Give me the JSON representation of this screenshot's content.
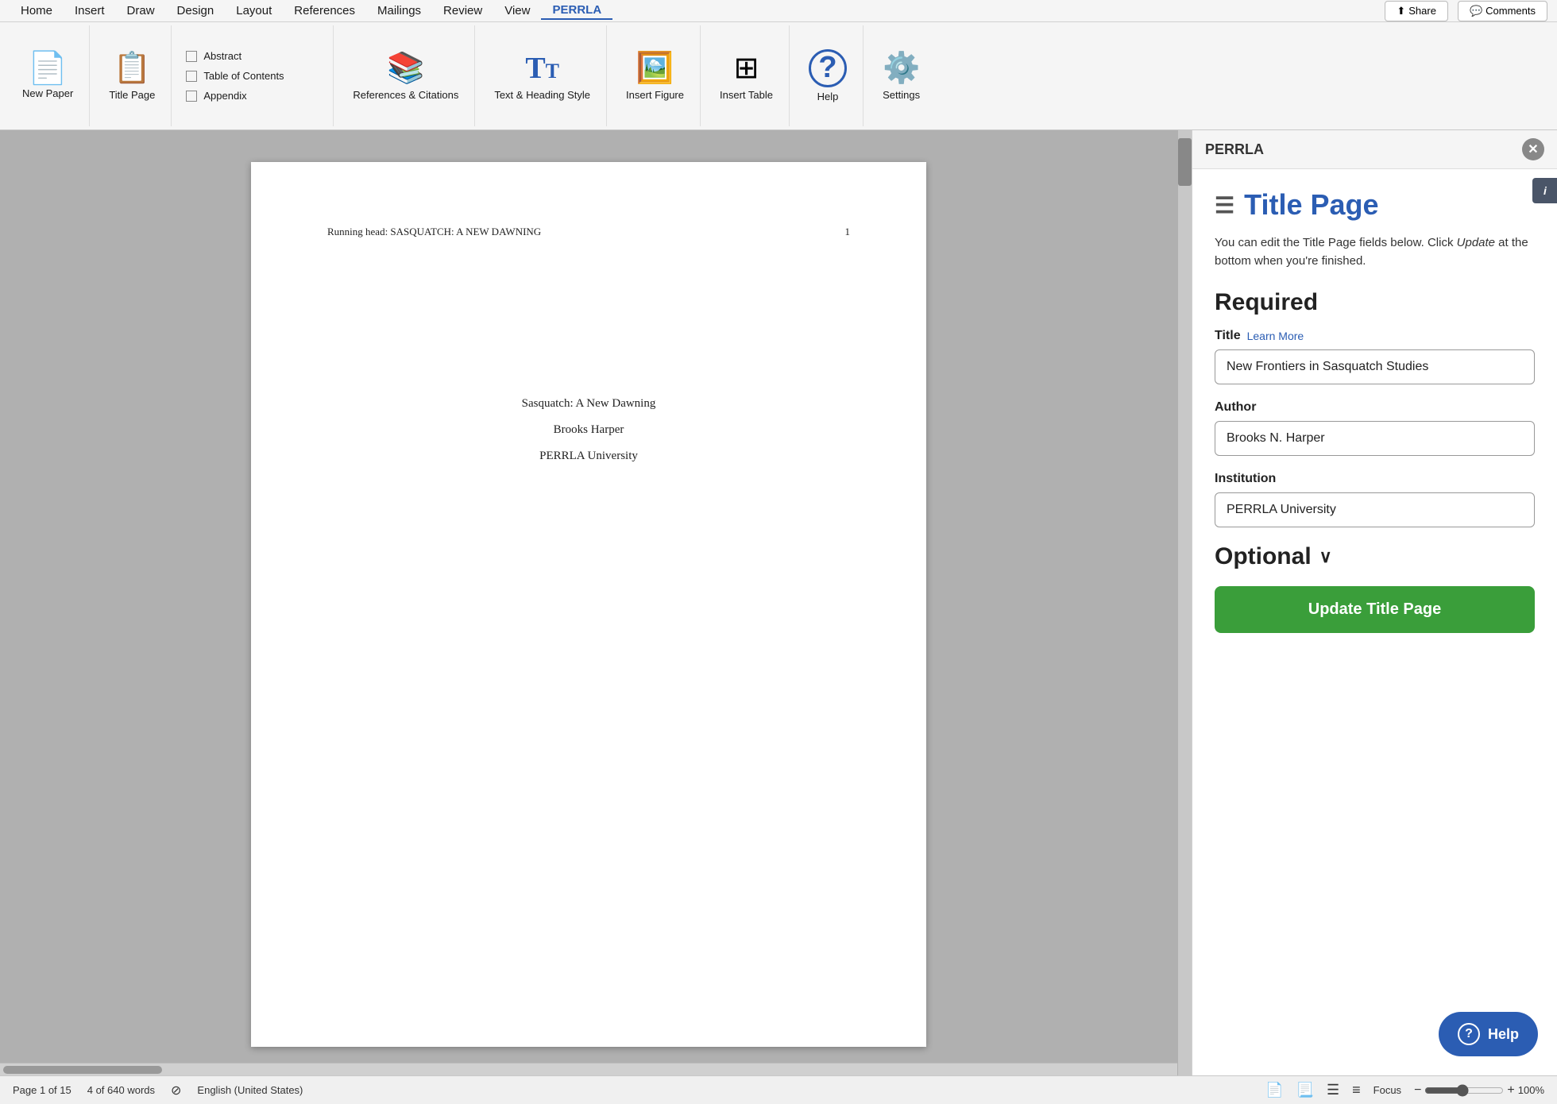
{
  "app": {
    "title": "PERRLA"
  },
  "menubar": {
    "items": [
      {
        "label": "Home",
        "active": false
      },
      {
        "label": "Insert",
        "active": false
      },
      {
        "label": "Draw",
        "active": false
      },
      {
        "label": "Design",
        "active": false
      },
      {
        "label": "Layout",
        "active": false
      },
      {
        "label": "References",
        "active": false
      },
      {
        "label": "Mailings",
        "active": false
      },
      {
        "label": "Review",
        "active": false
      },
      {
        "label": "View",
        "active": false
      },
      {
        "label": "PERRLA",
        "active": true
      }
    ],
    "share_label": "Share",
    "comments_label": "Comments"
  },
  "ribbon": {
    "new_paper_label": "New\nPaper",
    "title_page_label": "Title\nPage",
    "abstract_label": "Abstract",
    "table_of_contents_label": "Table of Contents",
    "appendix_label": "Appendix",
    "references_citations_label": "References &\nCitations",
    "text_heading_style_label": "Text &\nHeading Style",
    "insert_figure_label": "Insert\nFigure",
    "insert_table_label": "Insert\nTable",
    "help_label": "Help",
    "settings_label": "Settings"
  },
  "document": {
    "running_head": "Running head: SASQUATCH: A NEW DAWNING",
    "page_number": "1",
    "title": "Sasquatch: A New Dawning",
    "author": "Brooks Harper",
    "institution": "PERRLA University"
  },
  "status_bar": {
    "page_info": "Page 1 of 15",
    "word_count": "4 of 640 words",
    "language": "English (United States)",
    "focus_label": "Focus",
    "zoom_percent": "100%",
    "zoom_minus": "−",
    "zoom_plus": "+"
  },
  "panel": {
    "header_label": "PERRLA",
    "title": "Title Page",
    "description_part1": "You can edit the Title Page fields below. Click ",
    "description_em": "Update",
    "description_part2": " at the bottom when you're finished.",
    "required_heading": "Required",
    "title_label": "Title",
    "learn_more_label": "Learn More",
    "title_value": "New Frontiers in Sasquatch Studies",
    "author_label": "Author",
    "author_value": "Brooks N. Harper",
    "institution_label": "Institution",
    "institution_value": "PERRLA University",
    "optional_heading": "Optional",
    "update_button_label": "Update Title Page",
    "help_button_label": "Help"
  }
}
